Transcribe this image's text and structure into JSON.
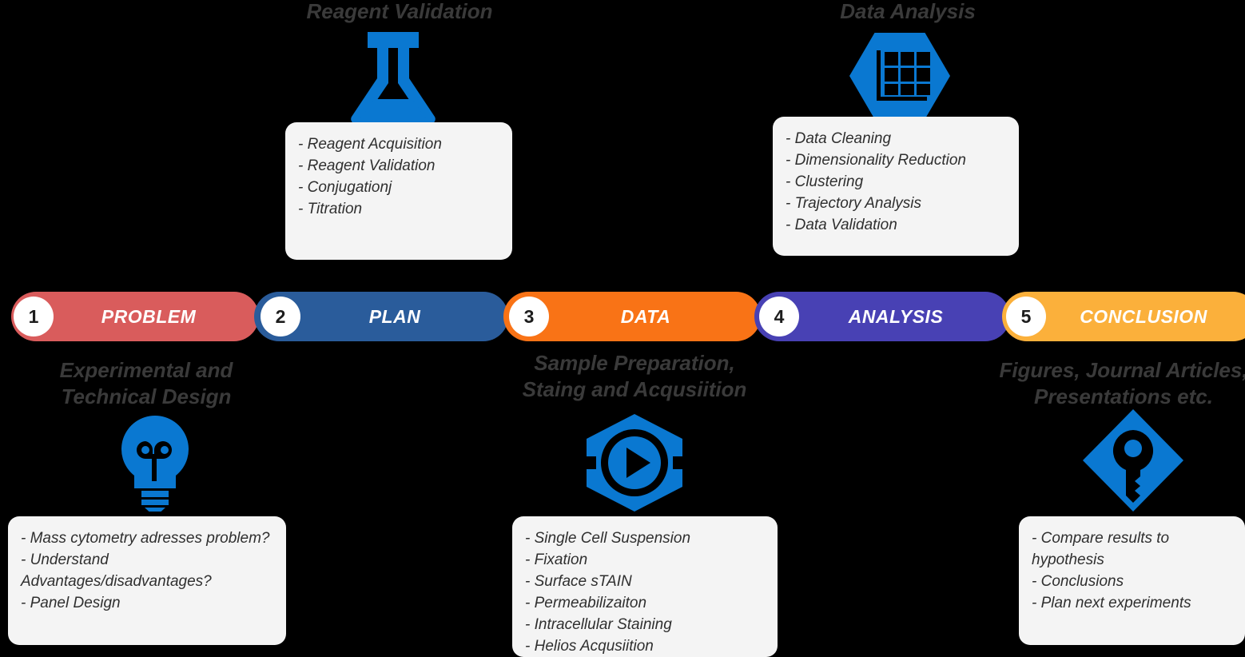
{
  "colors": {
    "accent_icon_blue": "#0A78D1",
    "card_bg": "#F4F4F4",
    "heading_gray": "#3A3A3A",
    "background": "#000000",
    "step1_red": "#D95C5C",
    "step2_blue": "#2A5C9B",
    "step3_orange": "#F97316",
    "step4_indigo": "#4841B4",
    "step5_amber": "#FBB03B",
    "badge_bg": "#FFFFFF"
  },
  "timeline": {
    "steps": [
      {
        "number": "1",
        "label": "PROBLEM",
        "color": "#D95C5C"
      },
      {
        "number": "2",
        "label": "PLAN",
        "color": "#2A5C9B"
      },
      {
        "number": "3",
        "label": "DATA",
        "color": "#F97316"
      },
      {
        "number": "4",
        "label": "ANALYSIS",
        "color": "#4841B4"
      },
      {
        "number": "5",
        "label": "CONCLUSION",
        "color": "#FBB03B"
      }
    ]
  },
  "headings": {
    "reagent_validation": "Reagent Validation",
    "data_analysis": "Data Analysis",
    "experimental_design": "Experimental and\nTechnical Design",
    "sample_preparation": "Sample Preparation,\nStaing and Acqusiition",
    "figures_output": "Figures, Journal Articles,\nPresentations etc."
  },
  "cards": {
    "plan": {
      "icon": "flask-icon",
      "items": "- Reagent Acquisition\n- Reagent Validation\n- Conjugationj\n- Titration"
    },
    "analysis": {
      "icon": "hexagon-grid-chart-icon",
      "items": "- Data Cleaning\n- Dimensionality Reduction\n- Clustering\n- Trajectory Analysis\n- Data Validation"
    },
    "problem": {
      "icon": "lightbulb-icon",
      "items": " - Mass cytometry adresses problem?\n- Understand Advantages/disadvantages?\n- Panel Design"
    },
    "data": {
      "icon": "hexagon-play-icon",
      "items": "- Single Cell Suspension\n- Fixation\n- Surface sTAIN\n- Permeabilizaiton\n- Intracellular Staining\n- Helios Acqusiition"
    },
    "conclusion": {
      "icon": "diamond-key-icon",
      "items": "- Compare results to hypothesis\n- Conclusions\n- Plan next experiments"
    }
  }
}
